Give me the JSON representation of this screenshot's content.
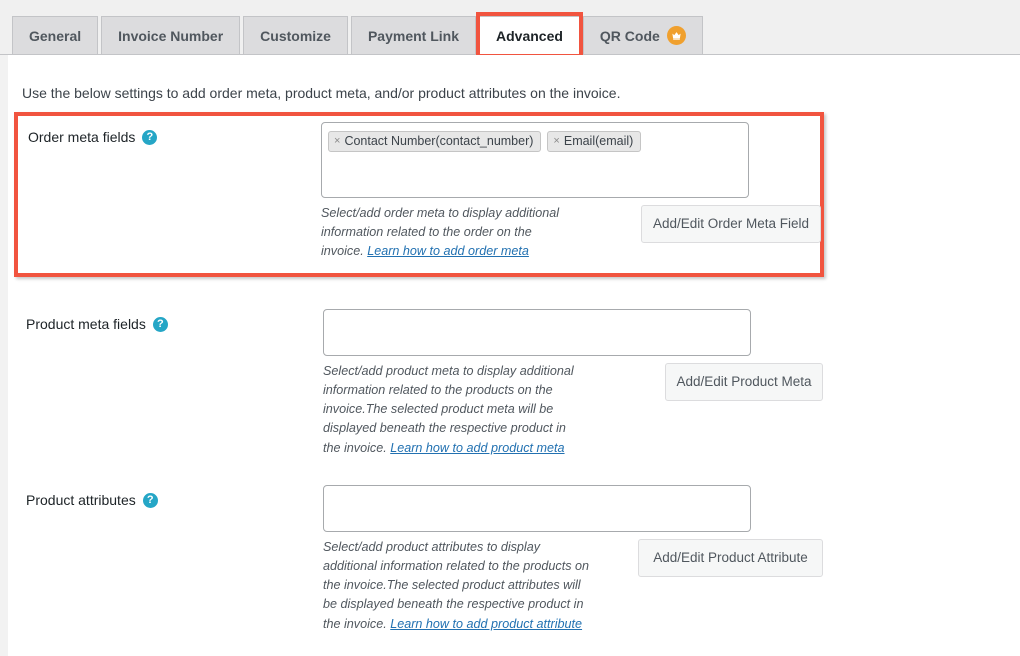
{
  "tabs": [
    {
      "id": "general",
      "label": "General",
      "active": false,
      "badge": null
    },
    {
      "id": "invoice-number",
      "label": "Invoice Number",
      "active": false,
      "badge": null
    },
    {
      "id": "customize",
      "label": "Customize",
      "active": false,
      "badge": null
    },
    {
      "id": "payment-link",
      "label": "Payment Link",
      "active": false,
      "badge": null
    },
    {
      "id": "advanced",
      "label": "Advanced",
      "active": true,
      "badge": null
    },
    {
      "id": "qr-code",
      "label": "QR Code",
      "active": false,
      "badge": "crown-icon"
    }
  ],
  "intro": "Use the below settings to add order meta, product meta, and/or product attributes on the invoice.",
  "help_icon_glyph": "?",
  "colors": {
    "highlight": "#f1543f",
    "help_icon": "#25a6c6",
    "crown_badge": "#f0a02e",
    "link": "#2271b1",
    "tab_strip_bg": "#f0f0f0",
    "tab_bg": "#dcdcde"
  },
  "rows": {
    "order_meta": {
      "label": "Order meta fields",
      "tokens": [
        {
          "remove": "×",
          "label": "Contact Number(contact_number)"
        },
        {
          "remove": "×",
          "label": "Email(email)"
        }
      ],
      "description_text": "Select/add order meta to display additional information related to the order on the invoice. ",
      "description_link": "Learn how to add order meta",
      "button_label": "Add/Edit Order Meta Field"
    },
    "product_meta": {
      "label": "Product meta fields",
      "tokens": [],
      "description_text": "Select/add product meta to display additional information related to the products on the invoice.The selected product meta will be displayed beneath the respective product in the invoice. ",
      "description_link": "Learn how to add product meta",
      "button_label": "Add/Edit Product Meta"
    },
    "product_attributes": {
      "label": "Product attributes",
      "tokens": [],
      "description_text": "Select/add product attributes to display additional information related to the products on the invoice.The selected product attributes will be displayed beneath the respective product in the invoice. ",
      "description_link": "Learn how to add product attribute",
      "button_label": "Add/Edit Product Attribute"
    }
  }
}
